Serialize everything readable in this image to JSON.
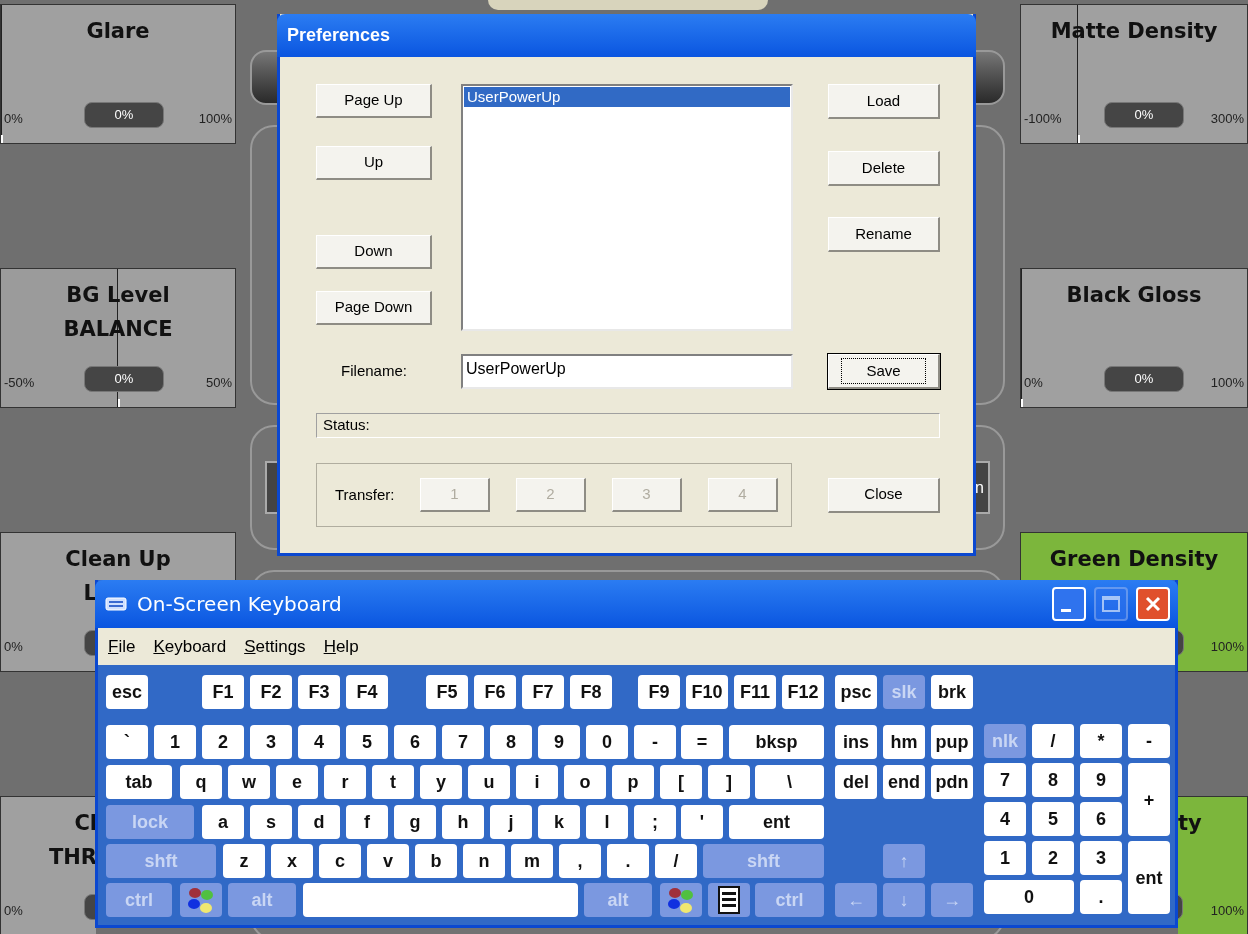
{
  "left_panels": [
    {
      "color": "#a0a0a0",
      "title_lines": [
        {
          "text": "Glare",
          "partial": false
        }
      ],
      "min": "0%",
      "value": "0%",
      "max": "100%",
      "level": 0
    },
    {
      "color": "#a0a0a0",
      "title_lines": [
        {
          "text": "BG Level",
          "partial": false
        },
        {
          "text": "BALANCE",
          "partial": false
        }
      ],
      "min": "-50%",
      "value": "0%",
      "max": "50%",
      "level": 0.5
    },
    {
      "color": "#a0a0a0",
      "title_lines": [
        {
          "text": "Clean Up",
          "partial": false
        },
        {
          "text": "L",
          "partial": true
        }
      ],
      "min": "0%"
    },
    {
      "color": "#a0a0a0",
      "title_lines": [
        {
          "text": "Cl",
          "partial": true
        },
        {
          "text": "THR",
          "partial": true
        }
      ],
      "min": "0%"
    }
  ],
  "right_panels": [
    {
      "color": "#a0a0a0",
      "title_lines": [
        {
          "text": "Matte Density",
          "partial": false
        }
      ],
      "min": "-100%",
      "value": "0%",
      "max": "300%",
      "level": 0.25
    },
    {
      "color": "#a0a0a0",
      "title_lines": [
        {
          "text": "Black Gloss",
          "partial": false
        }
      ],
      "min": "0%",
      "value": "0%",
      "max": "100%",
      "level": 0
    },
    {
      "color": "#7cb63c",
      "title_lines": [
        {
          "text": "Green Density",
          "partial": false
        }
      ],
      "max": "100%"
    },
    {
      "color": "#7cb63c",
      "title_lines": [
        {
          "text": "ty",
          "partial": true
        }
      ],
      "max": "100%"
    }
  ],
  "background": {
    "button_text": "n"
  },
  "preferences_dialog": {
    "title": "Preferences",
    "nav_buttons": [
      {
        "label": "Page Up"
      },
      {
        "label": "Up"
      },
      {
        "label": "Down"
      },
      {
        "label": "Page Down"
      }
    ],
    "presets": [
      {
        "label": "UserPowerUp",
        "selected": true
      }
    ],
    "action_buttons": [
      {
        "label": "Load"
      },
      {
        "label": "Delete"
      },
      {
        "label": "Rename"
      }
    ],
    "filename": {
      "label": "Filename:",
      "value": "UserPowerUp"
    },
    "save_button": {
      "label": "Save",
      "focused": true
    },
    "status": {
      "label": "Status:"
    },
    "transfer": {
      "label": "Transfer:",
      "buttons": [
        {
          "label": "1",
          "disabled": true
        },
        {
          "label": "2",
          "disabled": true
        },
        {
          "label": "3",
          "disabled": true
        },
        {
          "label": "4",
          "disabled": true
        }
      ]
    },
    "close_button": {
      "label": "Close"
    }
  },
  "keyboard_window": {
    "title": "On-Screen Keyboard",
    "window_buttons": [
      {
        "kind": "minimize",
        "disabled": false
      },
      {
        "kind": "maximize",
        "disabled": true
      },
      {
        "kind": "close",
        "disabled": false
      }
    ],
    "menu": [
      {
        "label": "File"
      },
      {
        "label": "Keyboard"
      },
      {
        "label": "Settings"
      },
      {
        "label": "Help"
      }
    ],
    "rows": [
      [
        {
          "label": "esc",
          "kind": "normal"
        },
        "",
        {
          "label": "F1",
          "kind": "normal"
        },
        {
          "label": "F2",
          "kind": "normal"
        },
        {
          "label": "F3",
          "kind": "normal"
        },
        {
          "label": "F4",
          "kind": "normal"
        },
        {
          "label": "F5",
          "kind": "normal"
        },
        {
          "label": "F6",
          "kind": "normal"
        },
        {
          "label": "F7",
          "kind": "normal"
        },
        {
          "label": "F8",
          "kind": "normal"
        },
        {
          "label": "F9",
          "kind": "normal"
        },
        {
          "label": "F10",
          "kind": "normal"
        },
        {
          "label": "F11",
          "kind": "normal"
        },
        {
          "label": "F12",
          "kind": "normal"
        },
        {
          "label": "psc",
          "kind": "normal"
        },
        {
          "label": "slk",
          "kind": "modifier"
        },
        {
          "label": "brk",
          "kind": "normal"
        }
      ],
      [
        {
          "label": "`",
          "kind": "normal"
        },
        {
          "label": "1",
          "kind": "normal"
        },
        {
          "label": "2",
          "kind": "normal"
        },
        {
          "label": "3",
          "kind": "normal"
        },
        {
          "label": "4",
          "kind": "normal"
        },
        {
          "label": "5",
          "kind": "normal"
        },
        {
          "label": "6",
          "kind": "normal"
        },
        {
          "label": "7",
          "kind": "normal"
        },
        {
          "label": "8",
          "kind": "normal"
        },
        {
          "label": "9",
          "kind": "normal"
        },
        {
          "label": "0",
          "kind": "normal"
        },
        {
          "label": "-",
          "kind": "normal"
        },
        {
          "label": "=",
          "kind": "normal"
        },
        {
          "label": "bksp",
          "kind": "normal"
        },
        {
          "label": "ins",
          "kind": "normal"
        },
        {
          "label": "hm",
          "kind": "normal"
        },
        {
          "label": "pup",
          "kind": "normal"
        }
      ],
      [
        {
          "label": "tab",
          "kind": "normal"
        },
        {
          "label": "q",
          "kind": "normal"
        },
        {
          "label": "w",
          "kind": "normal"
        },
        {
          "label": "e",
          "kind": "normal"
        },
        {
          "label": "r",
          "kind": "normal"
        },
        {
          "label": "t",
          "kind": "normal"
        },
        {
          "label": "y",
          "kind": "normal"
        },
        {
          "label": "u",
          "kind": "normal"
        },
        {
          "label": "i",
          "kind": "normal"
        },
        {
          "label": "o",
          "kind": "normal"
        },
        {
          "label": "p",
          "kind": "normal"
        },
        {
          "label": "[",
          "kind": "normal"
        },
        {
          "label": "]",
          "kind": "normal"
        },
        {
          "label": "\\",
          "kind": "normal"
        },
        {
          "label": "del",
          "kind": "normal"
        },
        {
          "label": "end",
          "kind": "normal"
        },
        {
          "label": "pdn",
          "kind": "normal"
        }
      ],
      [
        {
          "label": "lock",
          "kind": "modifier"
        },
        {
          "label": "a",
          "kind": "normal"
        },
        {
          "label": "s",
          "kind": "normal"
        },
        {
          "label": "d",
          "kind": "normal"
        },
        {
          "label": "f",
          "kind": "normal"
        },
        {
          "label": "g",
          "kind": "normal"
        },
        {
          "label": "h",
          "kind": "normal"
        },
        {
          "label": "j",
          "kind": "normal"
        },
        {
          "label": "k",
          "kind": "normal"
        },
        {
          "label": "l",
          "kind": "normal"
        },
        {
          "label": ";",
          "kind": "normal"
        },
        {
          "label": "'",
          "kind": "normal"
        },
        {
          "label": "ent",
          "kind": "normal"
        }
      ],
      [
        {
          "label": "shft",
          "kind": "modifier"
        },
        {
          "label": "z",
          "kind": "normal"
        },
        {
          "label": "x",
          "kind": "normal"
        },
        {
          "label": "c",
          "kind": "normal"
        },
        {
          "label": "v",
          "kind": "normal"
        },
        {
          "label": "b",
          "kind": "normal"
        },
        {
          "label": "n",
          "kind": "normal"
        },
        {
          "label": "m",
          "kind": "normal"
        },
        {
          "label": ",",
          "kind": "normal"
        },
        {
          "label": ".",
          "kind": "normal"
        },
        {
          "label": "/",
          "kind": "normal"
        },
        {
          "label": "shft",
          "kind": "modifier"
        },
        "",
        "",
        "",
        {
          "label": "↑",
          "kind": "modifier"
        }
      ],
      [
        {
          "label": "ctrl",
          "kind": "modifier"
        },
        {
          "kind": "logo"
        },
        {
          "label": "alt",
          "kind": "modifier"
        },
        {
          "kind": "space"
        },
        {
          "label": "alt",
          "kind": "modifier"
        },
        {
          "kind": "logo"
        },
        {
          "kind": "menu"
        },
        "",
        "",
        "",
        "",
        "",
        "",
        {
          "label": "ctrl",
          "kind": "modifier"
        },
        {
          "label": "←",
          "kind": "modifier"
        },
        {
          "label": "↓",
          "kind": "modifier"
        },
        {
          "label": "→",
          "kind": "modifier"
        }
      ]
    ],
    "numpad": [
      {
        "label": "nlk",
        "kind": "modifier"
      },
      {
        "label": "/",
        "kind": "normal"
      },
      {
        "label": "*",
        "kind": "normal"
      },
      {
        "label": "-",
        "kind": "normal"
      },
      {
        "label": "7",
        "kind": "normal"
      },
      {
        "label": "8",
        "kind": "normal"
      },
      {
        "label": "9",
        "kind": "normal"
      },
      {
        "label": "+",
        "kind": "normal"
      },
      {
        "label": "4",
        "kind": "normal"
      },
      {
        "label": "5",
        "kind": "normal"
      },
      {
        "label": "6",
        "kind": "normal"
      },
      {
        "label": "1",
        "kind": "normal"
      },
      {
        "label": "2",
        "kind": "normal"
      },
      {
        "label": "3",
        "kind": "normal"
      },
      {
        "label": "ent",
        "kind": "normal"
      },
      {
        "label": "0",
        "kind": "normal"
      },
      {
        "label": ".",
        "kind": "normal"
      }
    ]
  }
}
